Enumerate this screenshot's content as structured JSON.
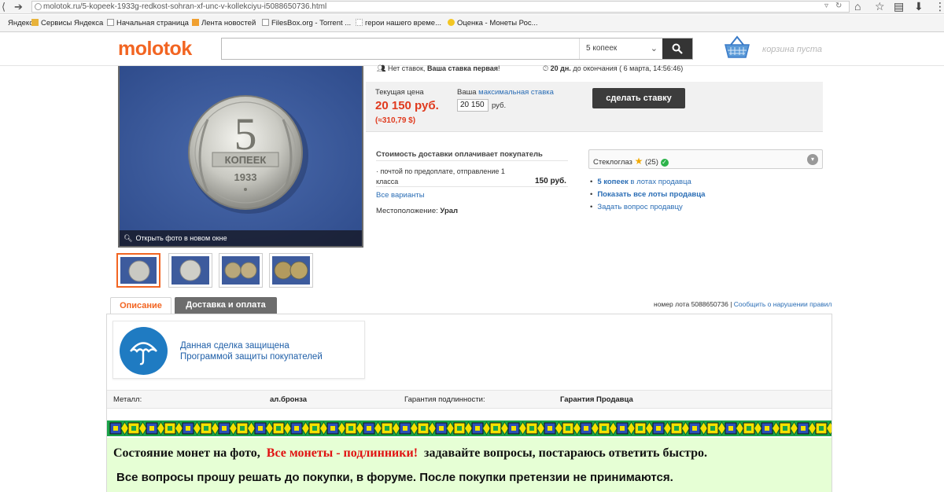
{
  "browser": {
    "url": "molotok.ru/5-kopeek-1933g-redkost-sohran-xf-unc-v-kollekciyu-i5088650736.html",
    "bookmarks": [
      {
        "label": "Яндекс",
        "icon": "yandex-icon"
      },
      {
        "label": "Сервисы Яндекса",
        "icon": "folder-icon"
      },
      {
        "label": "Начальная страница",
        "icon": "page-icon"
      },
      {
        "label": "Лента новостей",
        "icon": "rss-icon"
      },
      {
        "label": "FilesBox.org - Torrent ...",
        "icon": "page-icon"
      },
      {
        "label": "герои нашего време...",
        "icon": "page-icon"
      },
      {
        "label": "Оценка - Монеты Рос...",
        "icon": "smiley-icon"
      }
    ]
  },
  "header": {
    "logo": "molotok",
    "search_value": "",
    "search_category": "5 копеек",
    "cart_text": "корзина пуста"
  },
  "photo": {
    "open_label": "Открыть фото в новом окне",
    "coin_denom": "5",
    "coin_word": "КОПЕЕК",
    "coin_year": "1933",
    "thumbnail_count": 4
  },
  "auction": {
    "no_bids": "Нет ставок,",
    "first_bid": "Ваша ставка первая",
    "ends_days": "20 дн.",
    "ends_text": "до окончания ( 6 марта, 14:56:46)",
    "current_price_label": "Текущая цена",
    "current_price": "20 150 руб.",
    "current_price_usd": "(≈310,79 $)",
    "your_label": "Ваша",
    "max_bid_link": "максимальная ставка",
    "bid_value": "20 150",
    "bid_currency": "руб.",
    "bid_button": "сделать ставку"
  },
  "shipping": {
    "title": "Стоимость доставки оплачивает покупатель",
    "item": "почтой по предоплате, отправление 1 класса",
    "item_price": "150 руб.",
    "all_variants": "Все варианты",
    "location_label": "Местоположение:",
    "location": "Урал"
  },
  "seller": {
    "name": "Стеклоглаз",
    "rating": "(25)",
    "links": [
      {
        "bold": "5 копеек",
        "rest": " в лотах продавца"
      },
      {
        "bold": "Показать все лоты продавца",
        "rest": ""
      },
      {
        "bold": "",
        "rest": "Задать вопрос продавцу"
      }
    ]
  },
  "tabs": {
    "description": "Описание",
    "delivery": "Доставка и оплата",
    "lot_number": "номер лота 5088650736",
    "report": "Сообщить о нарушении правил"
  },
  "protection": {
    "line1": "Данная сделка защищена",
    "line2": "Программой защиты покупателей"
  },
  "properties": {
    "metal_label": "Металл:",
    "metal_value": "ал.бронза",
    "guarantee_label": "Гарантия подлинности:",
    "guarantee_value": "Гарантия Продавца"
  },
  "notice": {
    "part1": "Состояние монет на фото,",
    "part2": "Все монеты - подлинники!",
    "part3": "задавайте вопросы, постараюсь ответить  быстро.",
    "line2": "Все вопросы прошу решать до покупки, в форуме. После покупки претензии не принимаются."
  },
  "colors": {
    "brand": "#f26522",
    "price": "#e03a1e",
    "link": "#2a6db5",
    "notice_bg": "#e6ffd5",
    "notice_red": "#e01212"
  }
}
